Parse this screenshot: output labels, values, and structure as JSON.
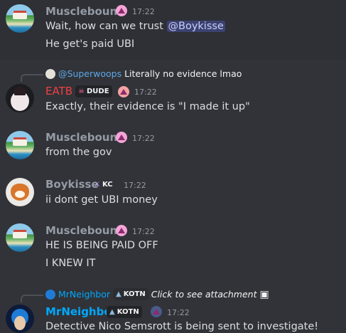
{
  "reactions": [
    {
      "icon": "green-circle",
      "glyph": "●",
      "color": "#78b159"
    },
    {
      "icon": "check-box",
      "glyph": "✓",
      "color": "#77b255"
    },
    {
      "icon": "crying-face",
      "glyph": "😭",
      "color": "#f4900c"
    }
  ],
  "messages": [
    {
      "author": "Musclebound",
      "time": "17:22",
      "lines": [
        "Wait, how can we trust ",
        "@Boykisse",
        "He get's paid UBI"
      ]
    },
    {
      "reply_to": {
        "author": "@Superwoops",
        "text": "Literally no evidence lmao"
      },
      "author": "EATB",
      "tag": "DUDE",
      "time": "17:22",
      "text": "Exactly, their evidence is \"I made it up\""
    },
    {
      "author": "Musclebound",
      "time": "17:22",
      "text": "from the gov"
    },
    {
      "author": "Boykisse",
      "tag": "KC",
      "time": "17:22",
      "text": "ii dont get UBI money"
    },
    {
      "author": "Musclebound",
      "time": "17:22",
      "lines": [
        "HE IS BEING PAID OFF",
        "I KNEW IT"
      ]
    },
    {
      "reply_to": {
        "author": "MrNeighbor",
        "tag": "KOTN",
        "text": "Click to see attachment"
      },
      "author": "MrNeighbor",
      "tag": "KOTN",
      "time": "17:22",
      "text": "Detective Nico Semsrott is being sent to investigate!"
    }
  ],
  "colors": {
    "background": "#313338",
    "musclebound": "#949ba4",
    "eatb": "#f23f43",
    "boykisse": "#949ba4",
    "mrneighbor": "#00a8fc",
    "superwoops": "#5ea7e8"
  }
}
